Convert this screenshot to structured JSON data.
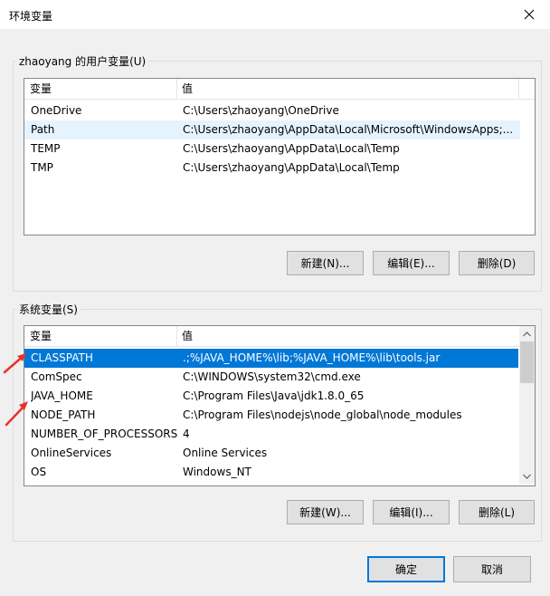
{
  "window": {
    "title": "环境变量"
  },
  "user_vars": {
    "group_label": "zhaoyang 的用户变量(U)",
    "columns": [
      "变量",
      "值"
    ],
    "rows": [
      {
        "name": "OneDrive",
        "value": "C:\\Users\\zhaoyang\\OneDrive"
      },
      {
        "name": "Path",
        "value": "C:\\Users\\zhaoyang\\AppData\\Local\\Microsoft\\WindowsApps;..."
      },
      {
        "name": "TEMP",
        "value": "C:\\Users\\zhaoyang\\AppData\\Local\\Temp"
      },
      {
        "name": "TMP",
        "value": "C:\\Users\\zhaoyang\\AppData\\Local\\Temp"
      }
    ],
    "buttons": {
      "new": "新建(N)...",
      "edit": "编辑(E)...",
      "delete": "删除(D)"
    }
  },
  "system_vars": {
    "group_label": "系统变量(S)",
    "columns": [
      "变量",
      "值"
    ],
    "rows": [
      {
        "name": "CLASSPATH",
        "value": ".;%JAVA_HOME%\\lib;%JAVA_HOME%\\lib\\tools.jar"
      },
      {
        "name": "ComSpec",
        "value": "C:\\WINDOWS\\system32\\cmd.exe"
      },
      {
        "name": "JAVA_HOME",
        "value": "C:\\Program Files\\Java\\jdk1.8.0_65"
      },
      {
        "name": "NODE_PATH",
        "value": "C:\\Program Files\\nodejs\\node_global\\node_modules"
      },
      {
        "name": "NUMBER_OF_PROCESSORS",
        "value": "4"
      },
      {
        "name": "OnlineServices",
        "value": "Online Services"
      },
      {
        "name": "OS",
        "value": "Windows_NT"
      }
    ],
    "buttons": {
      "new": "新建(W)...",
      "edit": "编辑(I)...",
      "delete": "删除(L)"
    }
  },
  "footer": {
    "ok": "确定",
    "cancel": "取消"
  },
  "colors": {
    "selection": "#0078d7",
    "hover": "#e5f3ff",
    "annotation_arrow": "#e8322b"
  },
  "icons": [
    "close-icon",
    "scroll-up-icon",
    "scroll-down-icon",
    "annotation-arrow-icon"
  ]
}
